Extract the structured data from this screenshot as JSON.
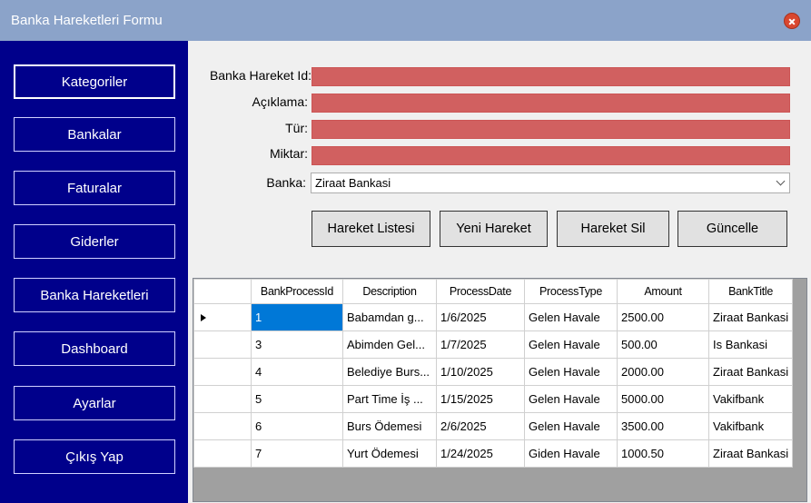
{
  "window": {
    "title": "Banka Hareketleri Formu"
  },
  "sidebar": {
    "items": [
      {
        "label": "Kategoriler"
      },
      {
        "label": "Bankalar"
      },
      {
        "label": "Faturalar"
      },
      {
        "label": "Giderler"
      },
      {
        "label": "Banka Hareketleri"
      },
      {
        "label": "Dashboard"
      },
      {
        "label": "Ayarlar"
      },
      {
        "label": "Çıkış Yap"
      }
    ]
  },
  "form": {
    "labels": {
      "id": "Banka Hareket Id:",
      "description": "Açıklama:",
      "type": "Tür:",
      "amount": "Miktar:",
      "bank": "Banka:"
    },
    "values": {
      "id": "",
      "description": "",
      "type": "",
      "amount": ""
    },
    "bank_selected": "Ziraat Bankasi",
    "field_color": "#d16060"
  },
  "actions": {
    "list": "Hareket Listesi",
    "new": "Yeni Hareket",
    "delete": "Hareket Sil",
    "update": "Güncelle"
  },
  "grid": {
    "columns": [
      "BankProcessId",
      "Description",
      "ProcessDate",
      "ProcessType",
      "Amount",
      "BankTitle"
    ],
    "rows": [
      [
        "1",
        "Babamdan g...",
        "1/6/2025",
        "Gelen Havale",
        "2500.00",
        "Ziraat Bankasi"
      ],
      [
        "3",
        "Abimden Gel...",
        "1/7/2025",
        "Gelen Havale",
        "500.00",
        "Is Bankasi"
      ],
      [
        "4",
        "Belediye Burs...",
        "1/10/2025",
        "Gelen Havale",
        "2000.00",
        "Ziraat Bankasi"
      ],
      [
        "5",
        "Part Time İş ...",
        "1/15/2025",
        "Gelen Havale",
        "5000.00",
        "Vakifbank"
      ],
      [
        "6",
        "Burs Ödemesi",
        "2/6/2025",
        "Gelen Havale",
        "3500.00",
        "Vakifbank"
      ],
      [
        "7",
        "Yurt Ödemesi",
        "1/24/2025",
        "Giden Havale",
        "1000.50",
        "Ziraat Bankasi"
      ]
    ]
  },
  "colors": {
    "sidebar": "#00008b",
    "titlebar": "#8ba3c9",
    "selection": "#0078d7"
  }
}
